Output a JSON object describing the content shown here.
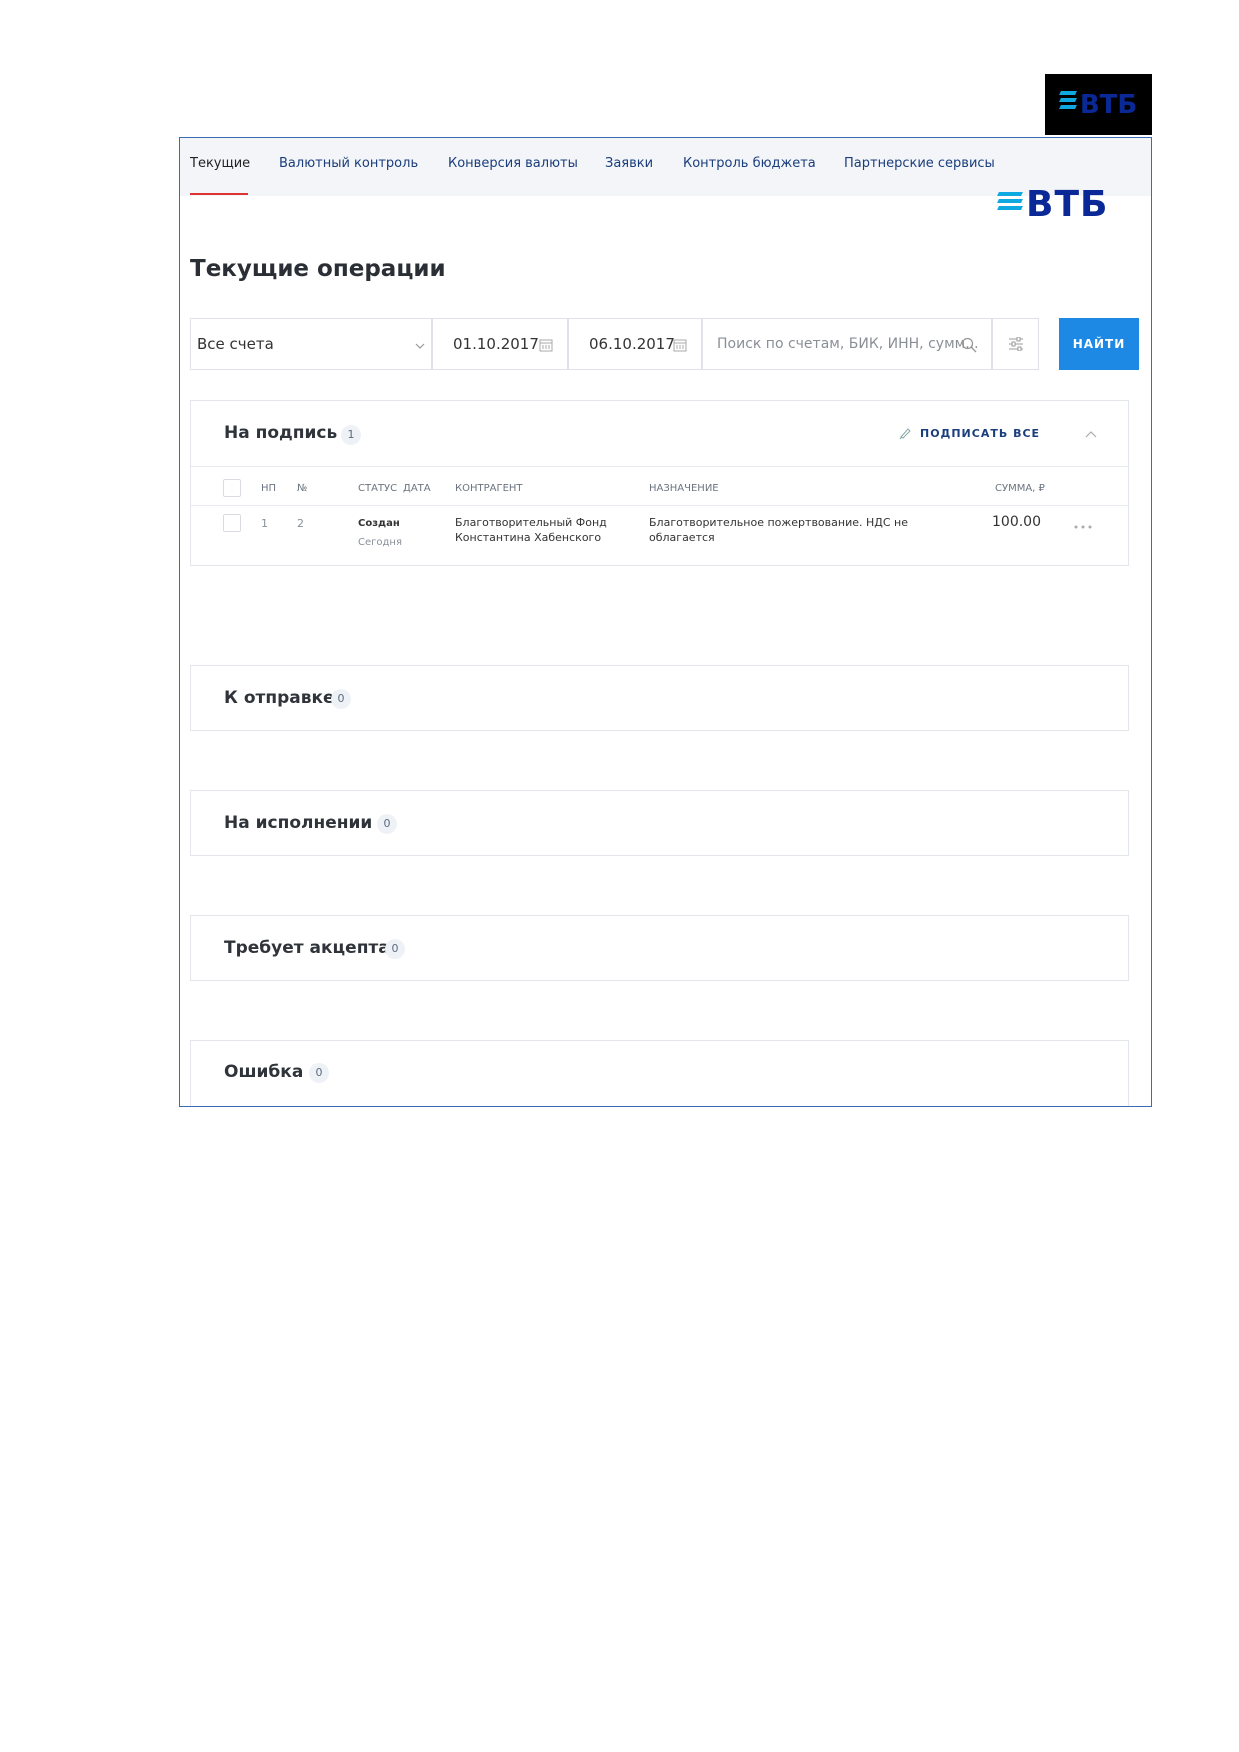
{
  "header_logo": {
    "text": "ВТБ"
  },
  "nav": {
    "tabs": [
      {
        "label": "Текущие",
        "active": true
      },
      {
        "label": "Валютный контроль"
      },
      {
        "label": "Конверсия валюты"
      },
      {
        "label": "Заявки"
      },
      {
        "label": "Контроль бюджета"
      },
      {
        "label": "Партнерские сервисы"
      }
    ]
  },
  "brand": {
    "text": "ВТБ"
  },
  "page": {
    "title": "Текущие операции"
  },
  "filters": {
    "account": "Все счета",
    "date_from": "01.10.2017",
    "date_to": "06.10.2017",
    "search_placeholder": "Поиск по счетам, БИК, ИНН, сумм...",
    "find_label": "НАЙТИ"
  },
  "sections": {
    "to_sign": {
      "title": "На подпись",
      "count": "1",
      "sign_all_label": "ПОДПИСАТЬ ВСЕ",
      "columns": {
        "np": "НП",
        "num": "№",
        "status": "СТАТУС",
        "date": "ДАТА",
        "counterparty": "КОНТРАГЕНТ",
        "purpose": "НАЗНАЧЕНИЕ",
        "amount": "СУММА, ₽"
      },
      "rows": [
        {
          "np": "1",
          "num": "2",
          "status": "Создан",
          "date": "Сегодня",
          "counterparty": "Благотворительный Фонд Константина Хабенского",
          "purpose": "Благотворительное пожертвование. НДС не облагается",
          "amount": "100.00"
        }
      ]
    },
    "to_send": {
      "title": "К отправке",
      "count": "0"
    },
    "in_progress": {
      "title": "На исполнении",
      "count": "0"
    },
    "acceptance": {
      "title": "Требует акцепта",
      "count": "0"
    },
    "error": {
      "title": "Ошибка",
      "count": "0"
    }
  },
  "colors": {
    "accent": "#1e88e5",
    "brand_blue": "#0a2896",
    "brand_stripe": "#0fa8e0",
    "active_tab_underline": "#dd3333"
  }
}
